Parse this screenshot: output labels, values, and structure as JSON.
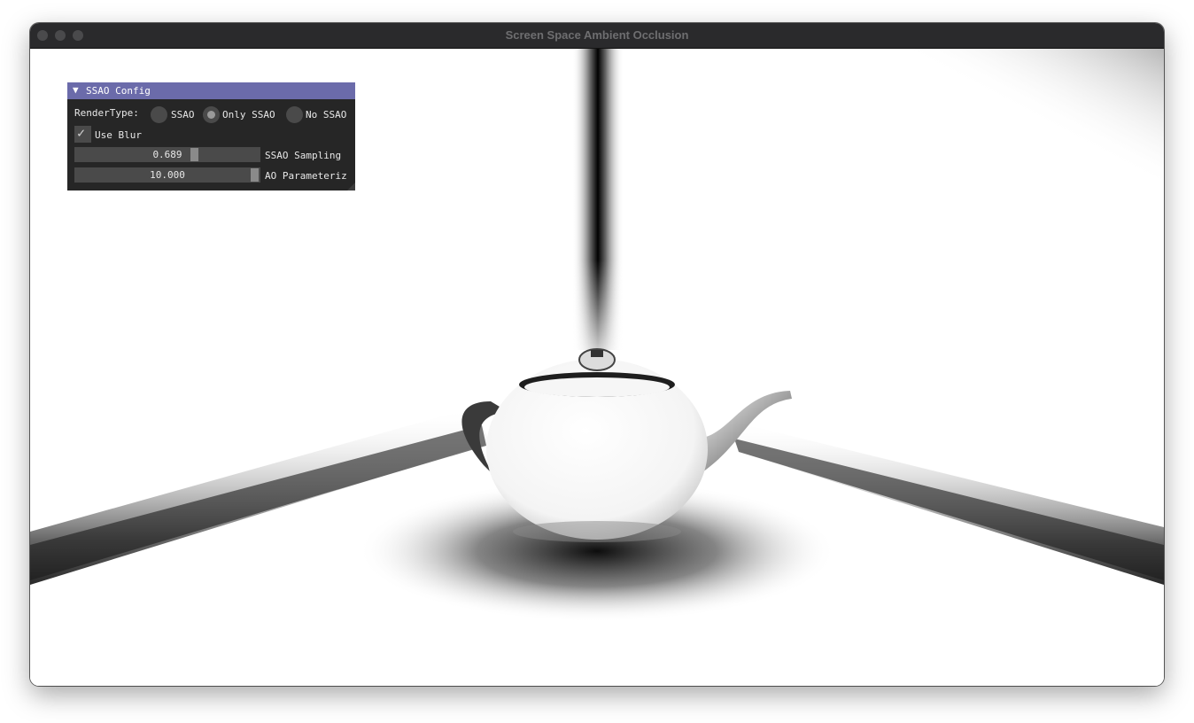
{
  "window": {
    "title": "Screen Space Ambient Occlusion"
  },
  "panel": {
    "title": "SSAO Config",
    "collapse_arrow": "▼",
    "render_type": {
      "label": "RenderType:",
      "options": [
        "SSAO",
        "Only SSAO",
        "No SSAO"
      ],
      "selected": "Only SSAO"
    },
    "use_blur": {
      "label": "Use Blur",
      "checked": true,
      "check_glyph": "✓"
    },
    "ssao_sampling": {
      "value": "0.689",
      "label": "SSAO Sampling"
    },
    "ao_param": {
      "value": "10.000",
      "label": "AO Parameteriz"
    }
  },
  "colors": {
    "header": "#6b6baa",
    "panel_bg": "#161616",
    "widget": "#4a4a4a"
  }
}
